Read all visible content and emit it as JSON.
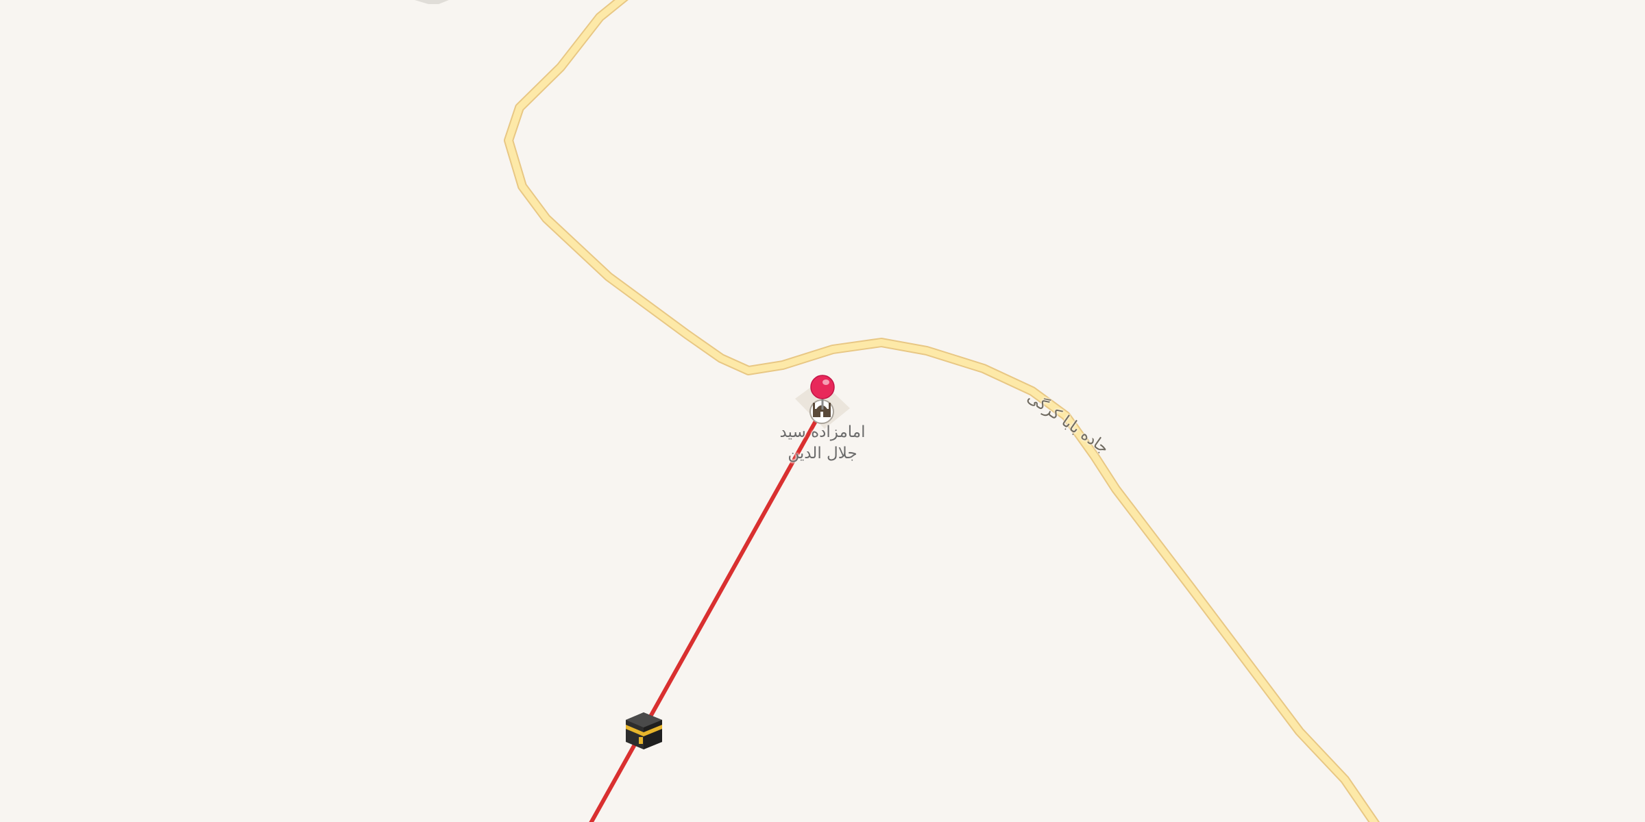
{
  "map": {
    "poi": {
      "name_line1": "امامزاده سید",
      "name_line2": "جلال الدین",
      "icon": "mosque-icon"
    },
    "road": {
      "name": "جاده بابا کرگی"
    },
    "pin": {
      "icon": "location-pin-icon"
    },
    "destination": {
      "icon": "kaaba-icon"
    },
    "colors": {
      "background": "#f8f5f1",
      "road_fill": "#fde9a8",
      "road_casing": "#e8c784",
      "qibla_line": "#d93030",
      "pin": "#e8285a"
    }
  }
}
